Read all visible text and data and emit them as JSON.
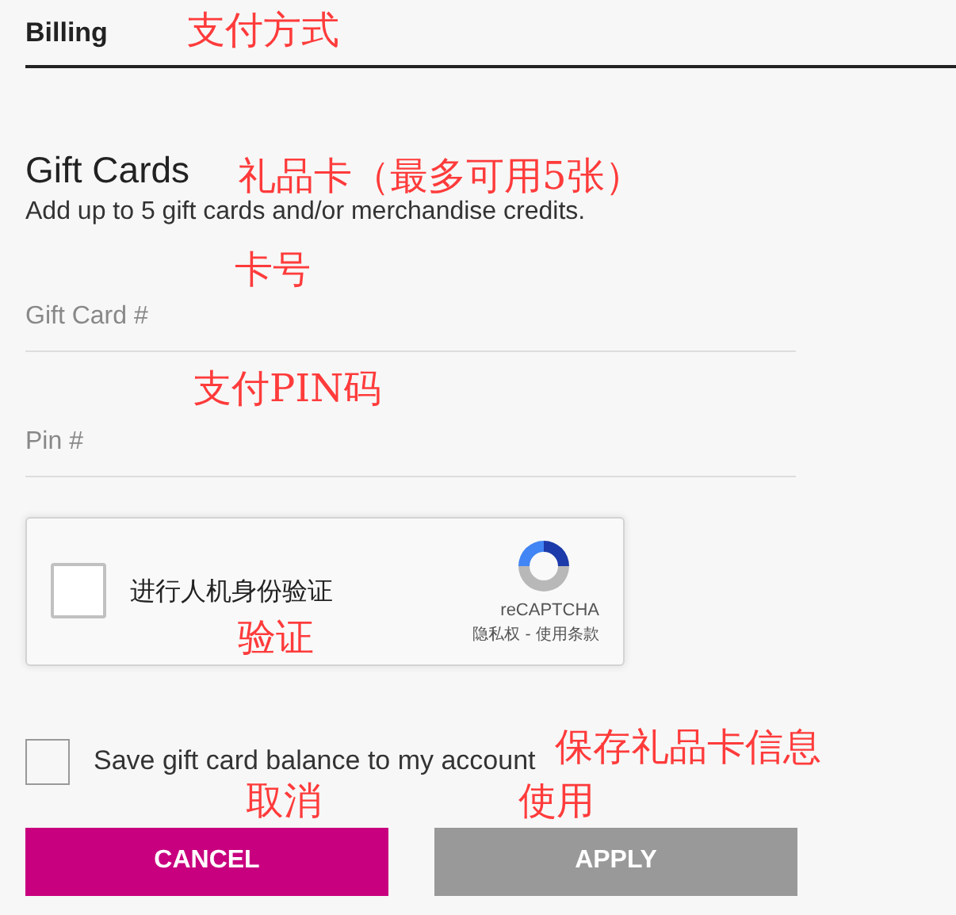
{
  "header": {
    "title": "Billing"
  },
  "gift_cards": {
    "title": "Gift Cards",
    "description": "Add up to 5 gift cards and/or merchandise credits."
  },
  "fields": [
    {
      "placeholder": "Gift Card #"
    },
    {
      "placeholder": "Pin #"
    }
  ],
  "captcha": {
    "label": "进行人机身份验证",
    "brand": "reCAPTCHA",
    "links": "隐私权 - 使用条款",
    "checked": false
  },
  "save_balance": {
    "label": "Save gift card balance to my account",
    "checked": false
  },
  "buttons": [
    {
      "label": "CANCEL",
      "disabled": false
    },
    {
      "label": "APPLY",
      "disabled": true
    }
  ],
  "annotations": [
    {
      "text": "支付方式"
    },
    {
      "text": "礼品卡（最多可用5张）"
    },
    {
      "text": "卡号"
    },
    {
      "text": "支付PIN码"
    },
    {
      "text": "验证"
    },
    {
      "text": "保存礼品卡信息"
    },
    {
      "text": "取消"
    },
    {
      "text": "使用"
    }
  ]
}
